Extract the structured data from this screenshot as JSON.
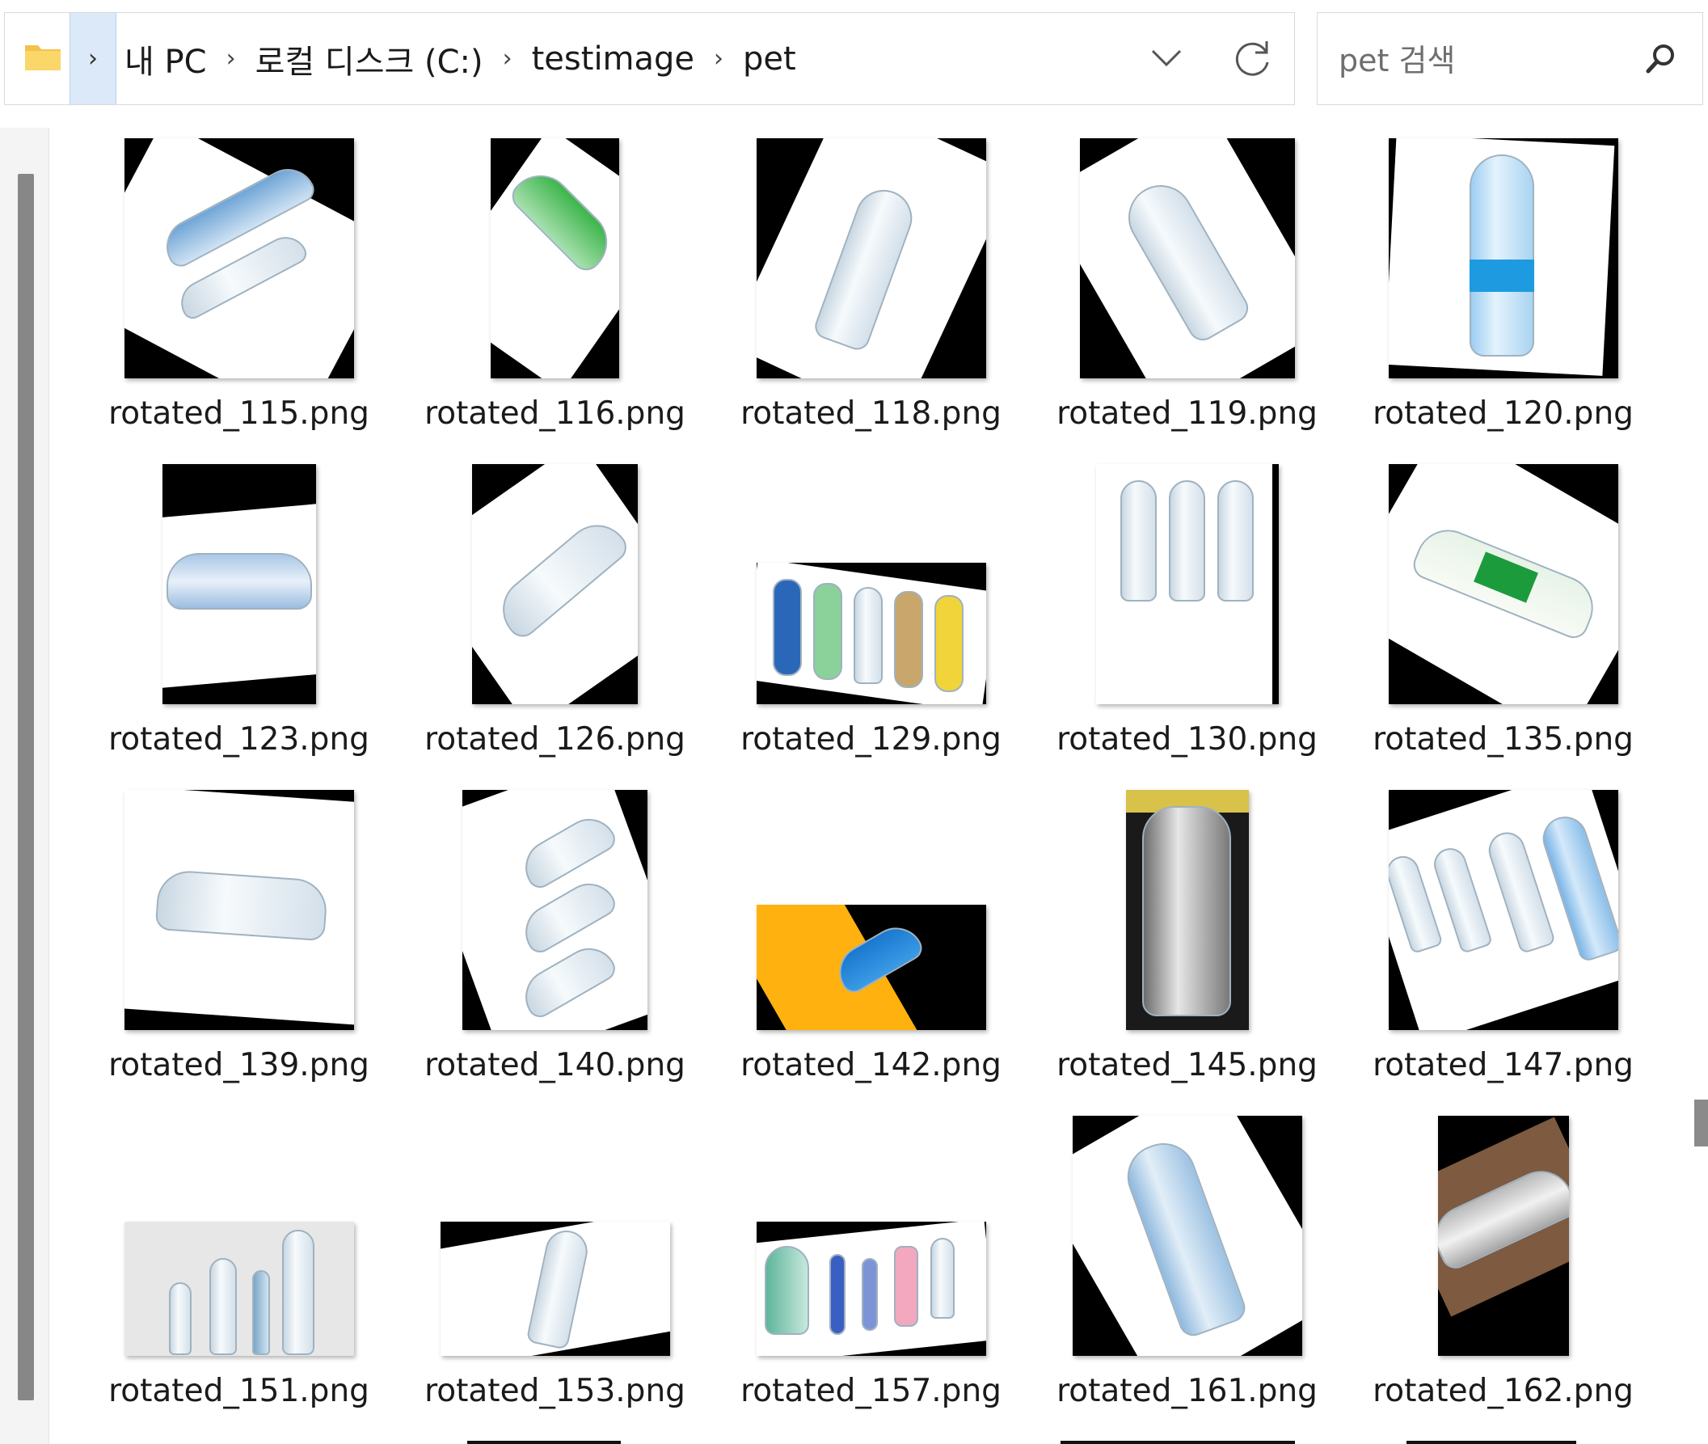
{
  "address_bar": {
    "breadcrumbs": [
      "내 PC",
      "로컬 디스크 (C:)",
      "testimage",
      "pet"
    ],
    "separator": "›",
    "expand_glyph": "›",
    "icons": {
      "folder": "folder-icon",
      "dropdown": "chevron-down-icon",
      "refresh": "refresh-icon"
    }
  },
  "search": {
    "placeholder": "pet 검색",
    "icon": "search-icon"
  },
  "files": [
    "rotated_115.png",
    "rotated_116.png",
    "rotated_118.png",
    "rotated_119.png",
    "rotated_120.png",
    "rotated_123.png",
    "rotated_126.png",
    "rotated_129.png",
    "rotated_130.png",
    "rotated_135.png",
    "rotated_139.png",
    "rotated_140.png",
    "rotated_142.png",
    "rotated_145.png",
    "rotated_147.png",
    "rotated_151.png",
    "rotated_153.png",
    "rotated_157.png",
    "rotated_161.png",
    "rotated_162.png"
  ],
  "colors": {
    "selection": "#dbe9f8",
    "thumbnail_background": "#000000",
    "scrollbar": "#878787"
  }
}
